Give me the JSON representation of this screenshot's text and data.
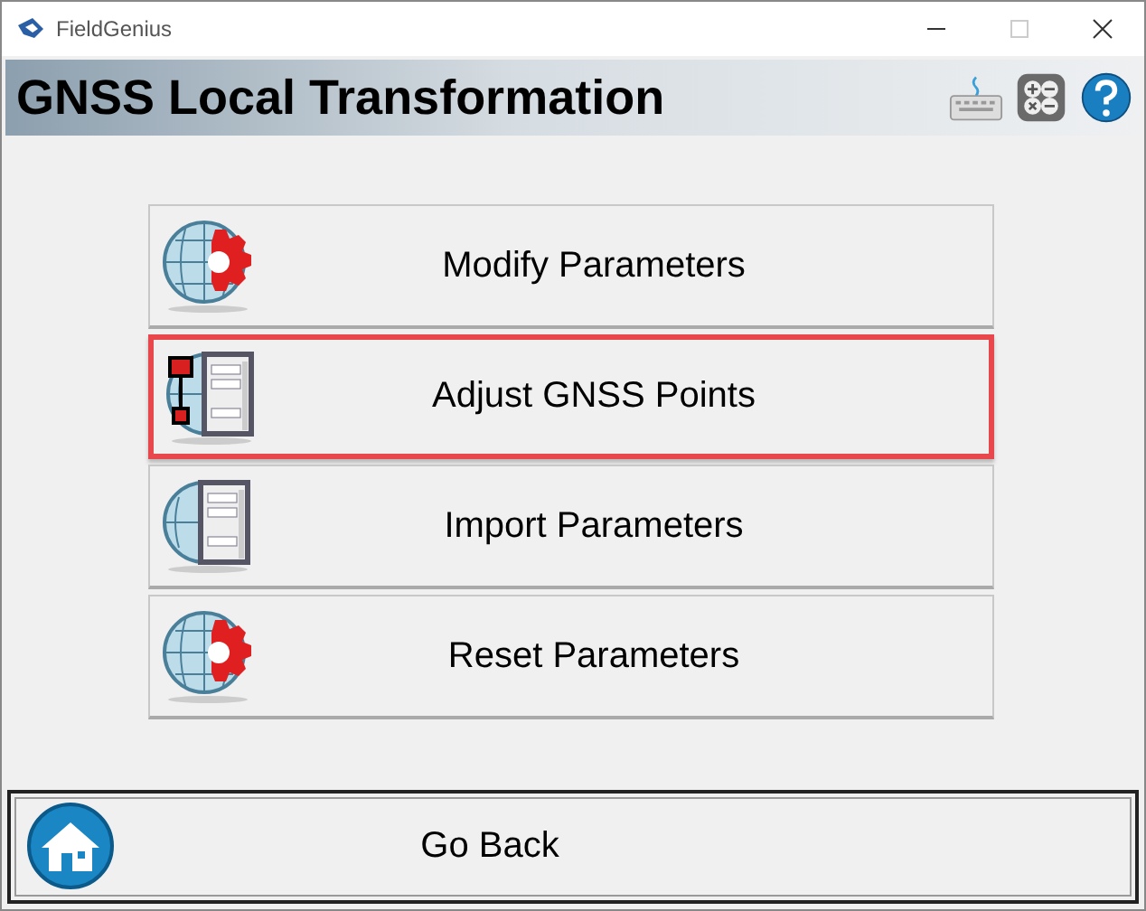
{
  "window": {
    "title": "FieldGenius"
  },
  "header": {
    "title": "GNSS Local Transformation"
  },
  "menu": [
    {
      "label": "Modify Parameters",
      "kind": "gear",
      "selected": false
    },
    {
      "label": "Adjust GNSS Points",
      "kind": "adjust",
      "selected": true
    },
    {
      "label": "Import Parameters",
      "kind": "table",
      "selected": false
    },
    {
      "label": "Reset Parameters",
      "kind": "gear",
      "selected": false
    }
  ],
  "footer": {
    "label": "Go Back"
  }
}
